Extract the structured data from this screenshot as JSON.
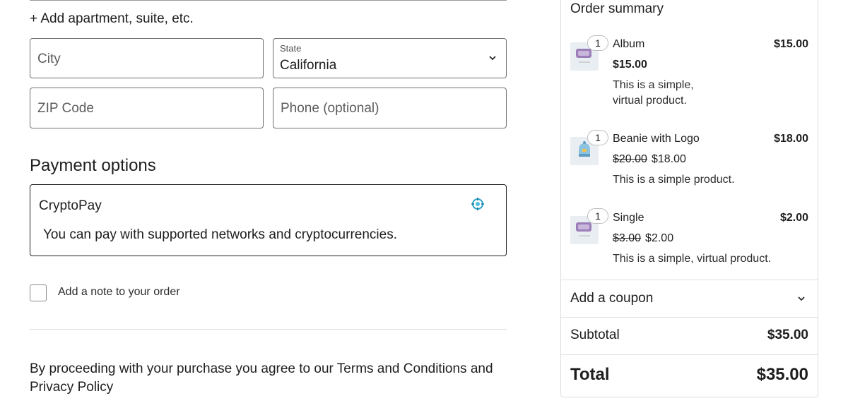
{
  "address": {
    "add_apartment_link": "+ Add apartment, suite, etc.",
    "city_placeholder": "City",
    "state_label": "State",
    "state_value": "California",
    "zip_placeholder": "ZIP Code",
    "phone_placeholder": "Phone (optional)"
  },
  "payment": {
    "section_title": "Payment options",
    "method_name": "CryptoPay",
    "method_description": "You can pay with supported networks and cryptocurrencies.",
    "method_icon": "cryptopay-logo-icon"
  },
  "note": {
    "label": "Add a note to your order",
    "checked": false
  },
  "terms_text": "By proceeding with your purchase you agree to our Terms and Conditions and Privacy Policy",
  "summary": {
    "title": "Order summary",
    "items": [
      {
        "qty": "1",
        "name": "Album",
        "line_total": "$15.00",
        "price": "$15.00",
        "old_price": "",
        "desc_line1": "This is a simple,",
        "desc_line2": "virtual product.",
        "thumb_icon": "woo-placeholder-icon"
      },
      {
        "qty": "1",
        "name": "Beanie with Logo",
        "line_total": "$18.00",
        "price": "$18.00",
        "old_price": "$20.00",
        "desc_line1": "This is a simple product.",
        "desc_line2": "",
        "thumb_icon": "beanie-image-icon"
      },
      {
        "qty": "1",
        "name": "Single",
        "line_total": "$2.00",
        "price": "$2.00",
        "old_price": "$3.00",
        "desc_line1": "This is a simple, virtual product.",
        "desc_line2": "",
        "thumb_icon": "woo-placeholder-icon"
      }
    ],
    "coupon_label": "Add a coupon",
    "subtotal_label": "Subtotal",
    "subtotal_value": "$35.00",
    "total_label": "Total",
    "total_value": "$35.00"
  },
  "colors": {
    "accent_icon": "#2aa3c9",
    "border_dark": "#1e1e1e",
    "border_light": "#dedede"
  }
}
